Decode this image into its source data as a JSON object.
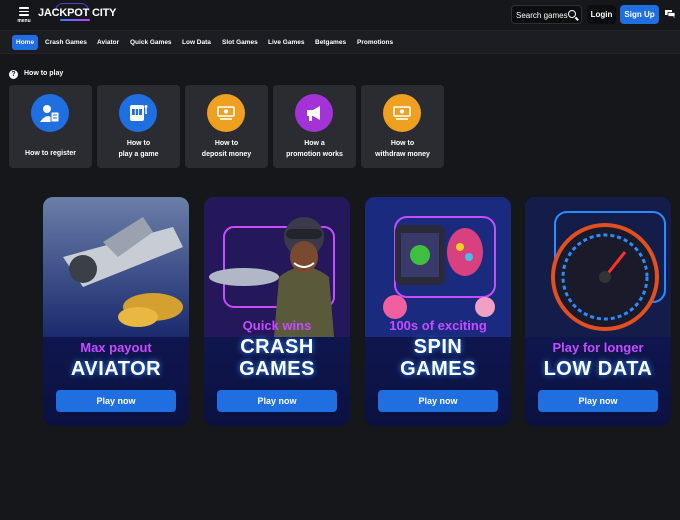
{
  "header": {
    "menu_label": "menu",
    "logo_text": "JACKPOT CITY",
    "search_placeholder": "Search games",
    "login_label": "Login",
    "signup_label": "Sign Up"
  },
  "nav": {
    "items": [
      "Home",
      "Crash Games",
      "Aviator",
      "Quick Games",
      "Low Data",
      "Slot Games",
      "Live Games",
      "Betgames",
      "Promotions"
    ],
    "active": "Home"
  },
  "howto": {
    "title": "How to play",
    "cards": [
      {
        "line1": "How to register",
        "line2": "",
        "icon": "user-document-icon",
        "color": "#1f6fe0"
      },
      {
        "line1": "How to",
        "line2": "play a game",
        "icon": "slot-machine-icon",
        "color": "#1f6fe0"
      },
      {
        "line1": "How to",
        "line2": "deposit money",
        "icon": "money-in-icon",
        "color": "#f0a020"
      },
      {
        "line1": "How a",
        "line2": "promotion works",
        "icon": "megaphone-icon",
        "color": "#a333d6"
      },
      {
        "line1": "How to",
        "line2": "withdraw money",
        "icon": "money-out-icon",
        "color": "#f0a020"
      }
    ]
  },
  "promos": [
    {
      "sub": "Max payout",
      "main": "AVIATOR",
      "button": "Play now",
      "art": "airplane-art"
    },
    {
      "sub": "Quick wins",
      "main": "CRASH GAMES",
      "button": "Play now",
      "art": "pilot-art"
    },
    {
      "sub": "100s of exciting",
      "main": "SPIN GAMES",
      "button": "Play now",
      "art": "slot-machine-art"
    },
    {
      "sub": "Play for longer",
      "main": "LOW DATA",
      "button": "Play now",
      "art": "speedometer-art"
    }
  ],
  "colors": {
    "accent": "#1f6fe0",
    "sub_purple": "#c64cff",
    "bg": "#16171b"
  }
}
